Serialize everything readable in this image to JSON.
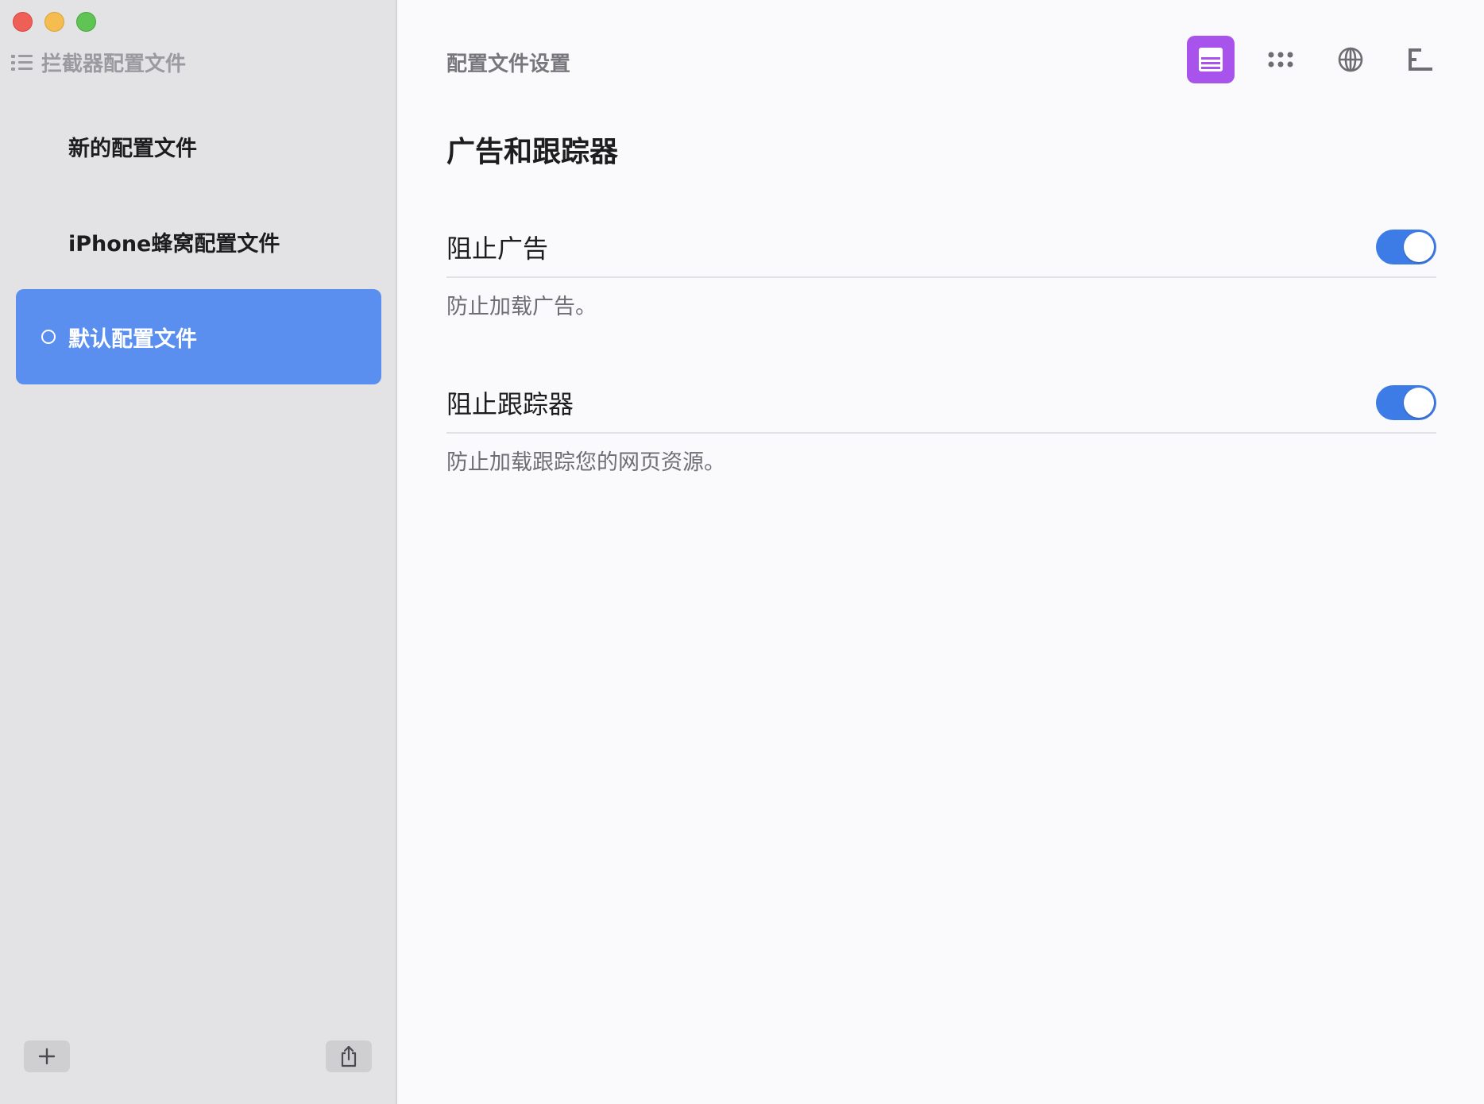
{
  "sidebar": {
    "header": "拦截器配置文件",
    "items": [
      {
        "label": "新的配置文件",
        "active": false
      },
      {
        "label": "iPhone蜂窝配置文件",
        "active": false
      },
      {
        "label": "默认配置文件",
        "active": true
      }
    ],
    "footer": {
      "add_icon": "plus-icon",
      "share_icon": "share-icon"
    }
  },
  "main": {
    "title": "配置文件设置",
    "toolbar": [
      {
        "icon": "list-icon",
        "active": true
      },
      {
        "icon": "grid-icon",
        "active": false
      },
      {
        "icon": "globe-icon",
        "active": false
      },
      {
        "icon": "tree-icon",
        "active": false
      }
    ],
    "section_title": "广告和跟踪器",
    "settings": [
      {
        "label": "阻止广告",
        "description": "防止加载广告。",
        "enabled": true
      },
      {
        "label": "阻止跟踪器",
        "description": "防止加载跟踪您的网页资源。",
        "enabled": true
      }
    ]
  },
  "colors": {
    "accent_selected": "#5a8ff0",
    "toolbar_active": "#a853ec",
    "toggle_on": "#3d7be6"
  }
}
